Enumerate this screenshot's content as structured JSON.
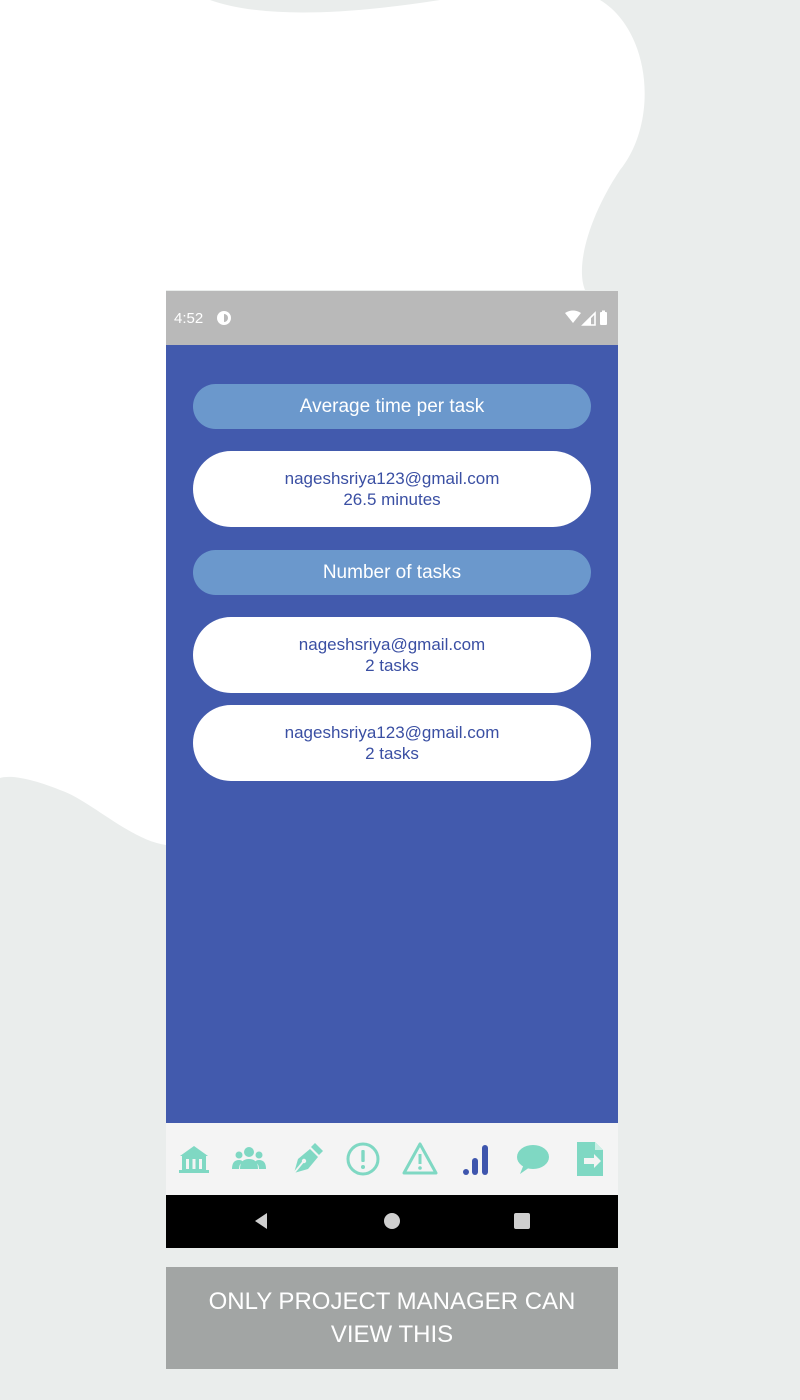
{
  "status_bar": {
    "time": "4:52",
    "app_icon": "circle-app-icon",
    "icons": [
      "wifi-icon",
      "signal-icon",
      "battery-icon"
    ]
  },
  "sections": {
    "average_time": {
      "header": "Average time per task",
      "items": [
        {
          "email": "nageshsriya123@gmail.com",
          "value": "26.5 minutes"
        }
      ]
    },
    "number_of_tasks": {
      "header": "Number of tasks",
      "items": [
        {
          "email": "nageshsriya@gmail.com",
          "value": "2 tasks"
        },
        {
          "email": "nageshsriya123@gmail.com",
          "value": "2 tasks"
        }
      ]
    }
  },
  "bottom_nav": {
    "items": [
      {
        "icon": "home-icon"
      },
      {
        "icon": "team-icon"
      },
      {
        "icon": "pen-icon"
      },
      {
        "icon": "alert-circle-icon"
      },
      {
        "icon": "warning-triangle-icon"
      },
      {
        "icon": "bar-chart-icon",
        "active": true
      },
      {
        "icon": "chat-icon"
      },
      {
        "icon": "document-icon"
      }
    ],
    "icon_color": "#7fd8c3",
    "active_color": "#3e55ad"
  },
  "system_nav": {
    "buttons": [
      "back-icon",
      "home-circle-icon",
      "recents-square-icon"
    ]
  },
  "notice": {
    "text": "ONLY PROJECT MANAGER CAN VIEW THIS"
  },
  "colors": {
    "background": "#eaedec",
    "blob": "#ffffff",
    "content_bg": "#425aad",
    "section_header_bg": "#6b98cc",
    "card_text": "#3a4fa3",
    "status_bar": "#b9b9b9",
    "notice_bg": "#a2a5a4"
  }
}
